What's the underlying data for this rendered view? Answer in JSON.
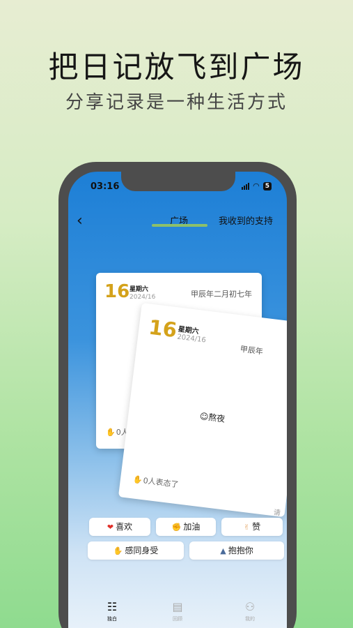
{
  "headline": "把日记放飞到广场",
  "subline": "分享记录是一种生活方式",
  "status_bar": {
    "time": "03:16",
    "battery": "5"
  },
  "header": {
    "tabs": [
      {
        "label": "广场",
        "active": true
      },
      {
        "label": "我收到的支持",
        "active": false
      }
    ]
  },
  "cards": [
    {
      "day": "16",
      "weekday": "星期六",
      "date": "2024/16",
      "lunar": "甲辰年二月初七年",
      "mood": "",
      "reactions": "0人表态"
    },
    {
      "day": "16",
      "weekday": "星期六",
      "date": "2024/16",
      "lunar": "甲辰年",
      "mood": "熬夜",
      "reactions": "0人表态了",
      "corner": "请"
    }
  ],
  "reaction_buttons": [
    {
      "label": "喜欢",
      "icon": "heart-icon"
    },
    {
      "label": "加油",
      "icon": "flexed-arm-icon"
    },
    {
      "label": "赞",
      "icon": "thumbs-up-icon"
    },
    {
      "label": "感同身受",
      "icon": "handshake-icon"
    },
    {
      "label": "抱抱你",
      "icon": "hug-icon"
    }
  ],
  "bottom_nav": [
    {
      "label": "独白",
      "icon": "scroll-icon",
      "active": true
    },
    {
      "label": "回顾",
      "icon": "book-icon",
      "active": false
    },
    {
      "label": "我的",
      "icon": "person-icon",
      "active": false
    }
  ],
  "colors": {
    "accent_gold": "#d4a21b",
    "tab_indicator": "#8cc06a",
    "screen_top": "#1d7fd6"
  }
}
